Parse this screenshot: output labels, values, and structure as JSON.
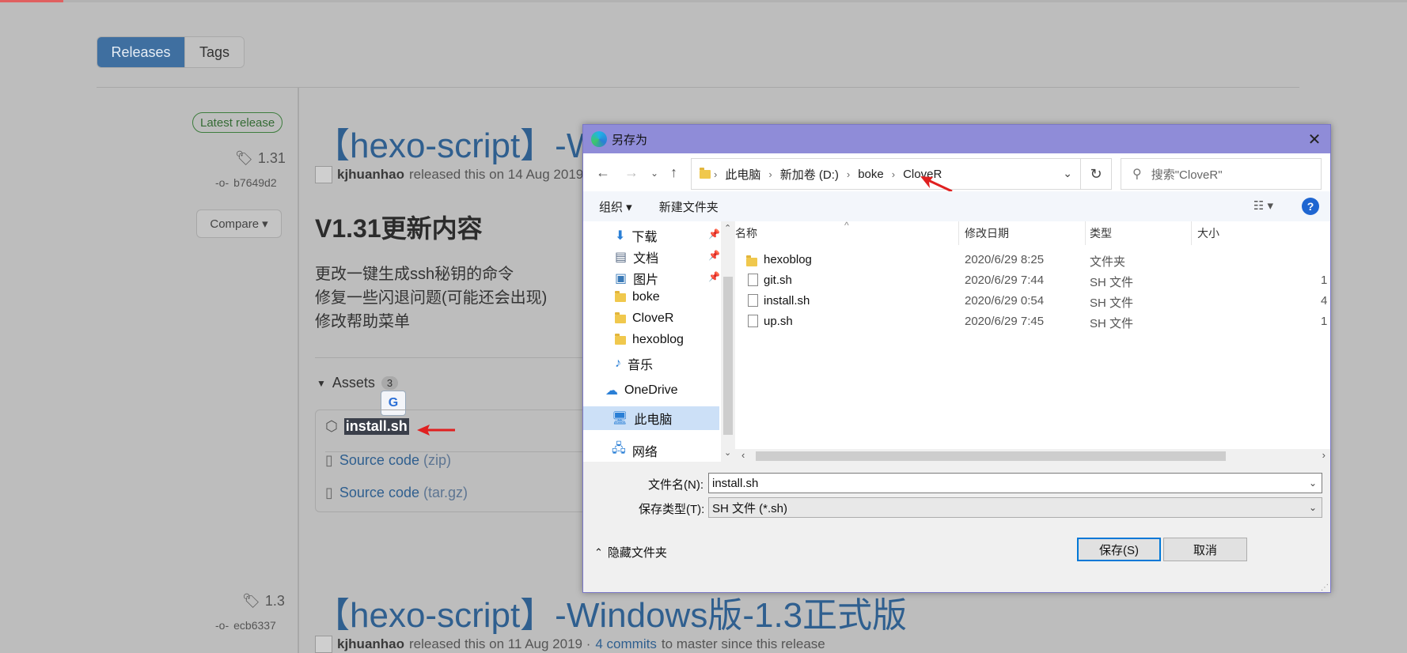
{
  "page": {
    "tabs": [
      "Releases",
      "Tags"
    ],
    "latest_badge": "Latest release",
    "release1": {
      "tag": "1.31",
      "commit": "b7649d2",
      "compare": "Compare",
      "title": "【hexo-script】-Wi",
      "author": "kjhuanhao",
      "byline": "released this on 14 Aug 2019",
      "heading": "V1.31更新内容",
      "notes": [
        "更改一键生成ssh秘钥的命令",
        "修复一些闪退问题(可能还会出现)",
        "修改帮助菜单"
      ],
      "assets_label": "Assets",
      "assets_count": "3",
      "assets": {
        "file": "install.sh",
        "zip_name": "Source code",
        "zip_ext": "(zip)",
        "tgz_name": "Source code",
        "tgz_ext": "(tar.gz)"
      }
    },
    "release2": {
      "tag": "1.3",
      "commit": "ecb6337",
      "title": "【hexo-script】-Windows版-1.3正式版",
      "author": "kjhuanhao",
      "byline_pre": "released this on 11 Aug 2019 ·",
      "commits_link": "4 commits",
      "byline_post": "to master since this release"
    }
  },
  "dialog": {
    "title": "另存为",
    "breadcrumb": [
      "此电脑",
      "新加卷 (D:)",
      "boke",
      "CloveR"
    ],
    "search_placeholder": "搜索\"CloveR\"",
    "toolbar": {
      "organize": "组织 ▾",
      "new_folder": "新建文件夹"
    },
    "nav_items": [
      {
        "label": "下载",
        "icon": "download-icon",
        "pinned": true
      },
      {
        "label": "文档",
        "icon": "document-icon",
        "pinned": true
      },
      {
        "label": "图片",
        "icon": "picture-icon",
        "pinned": true
      },
      {
        "label": "boke",
        "icon": "folder-icon",
        "pinned": false
      },
      {
        "label": "CloveR",
        "icon": "folder-icon",
        "pinned": false
      },
      {
        "label": "hexoblog",
        "icon": "folder-icon",
        "pinned": false
      },
      {
        "label": "音乐",
        "icon": "music-icon",
        "pinned": false
      },
      {
        "label": "OneDrive",
        "icon": "cloud-icon",
        "pinned": false
      },
      {
        "label": "此电脑",
        "icon": "computer-icon",
        "pinned": false
      },
      {
        "label": "网络",
        "icon": "network-icon",
        "pinned": false
      }
    ],
    "columns": [
      "名称",
      "修改日期",
      "类型",
      "大小"
    ],
    "files": [
      {
        "name": "hexoblog",
        "date": "2020/6/29 8:25",
        "type": "文件夹",
        "size": "",
        "icon": "folder-icon"
      },
      {
        "name": "git.sh",
        "date": "2020/6/29 7:44",
        "type": "SH 文件",
        "size": "1",
        "icon": "file-icon"
      },
      {
        "name": "install.sh",
        "date": "2020/6/29 0:54",
        "type": "SH 文件",
        "size": "4",
        "icon": "file-icon"
      },
      {
        "name": "up.sh",
        "date": "2020/6/29 7:45",
        "type": "SH 文件",
        "size": "1",
        "icon": "file-icon"
      }
    ],
    "filename_label": "文件名(N):",
    "filename_value": "install.sh",
    "filetype_label": "保存类型(T):",
    "filetype_value": "SH 文件 (*.sh)",
    "hide_folders": "隐藏文件夹",
    "save": "保存(S)",
    "cancel": "取消"
  },
  "colors": {
    "accent": "#0078d7",
    "titlebar": "#8f8cd8",
    "link": "#2f5f8f"
  }
}
